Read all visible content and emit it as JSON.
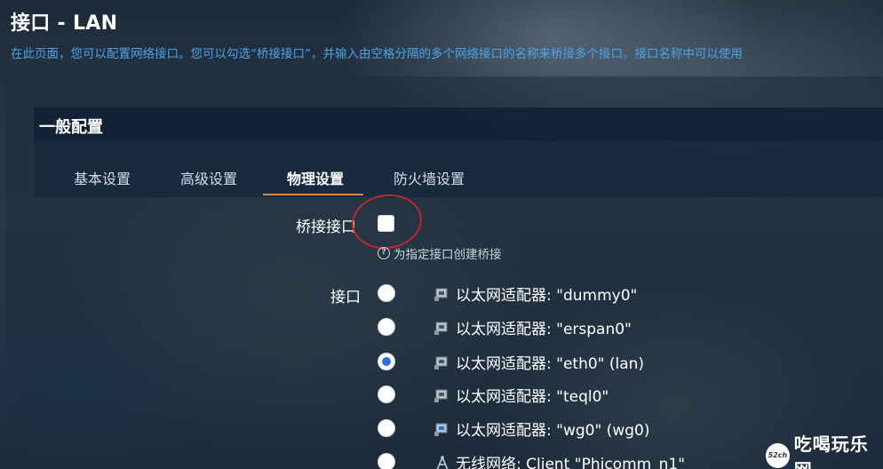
{
  "page": {
    "title": "接口 - LAN",
    "description": "在此页面，您可以配置网络接口。您可以勾选“桥接接口”，并输入由空格分隔的多个网络接口的名称来桥接多个接口。接口名称中可以使用"
  },
  "section": {
    "title": "一般配置",
    "tabs": [
      {
        "label": "基本设置",
        "active": false
      },
      {
        "label": "高级设置",
        "active": false
      },
      {
        "label": "物理设置",
        "active": true
      },
      {
        "label": "防火墙设置",
        "active": false
      }
    ]
  },
  "form": {
    "bridge_label": "桥接接口",
    "bridge_checked": false,
    "bridge_help": "为指定接口创建桥接",
    "interface_label": "接口",
    "interfaces": [
      {
        "label": "以太网适配器: \"dummy0\"",
        "selected": false,
        "icon": "ethernet-port-icon"
      },
      {
        "label": "以太网适配器: \"erspan0\"",
        "selected": false,
        "icon": "ethernet-port-icon"
      },
      {
        "label": "以太网适配器: \"eth0\" (lan)",
        "selected": true,
        "icon": "ethernet-port-icon"
      },
      {
        "label": "以太网适配器: \"teql0\"",
        "selected": false,
        "icon": "ethernet-port-icon"
      },
      {
        "label": "以太网适配器: \"wg0\" (wg0)",
        "selected": false,
        "icon": "ethernet-port-icon"
      },
      {
        "label": "无线网络: Client \"Phicomm_n1\"",
        "selected": false,
        "icon": "wifi-antenna-icon"
      }
    ]
  },
  "watermark": {
    "logo_text": "52ch",
    "text": "吃喝玩乐网"
  },
  "colors": {
    "accent_tab": "#e08a3a",
    "link_blue": "#4fa3e6",
    "radio_selected": "#2f6fd6",
    "annotation_red": "#c1272d"
  }
}
